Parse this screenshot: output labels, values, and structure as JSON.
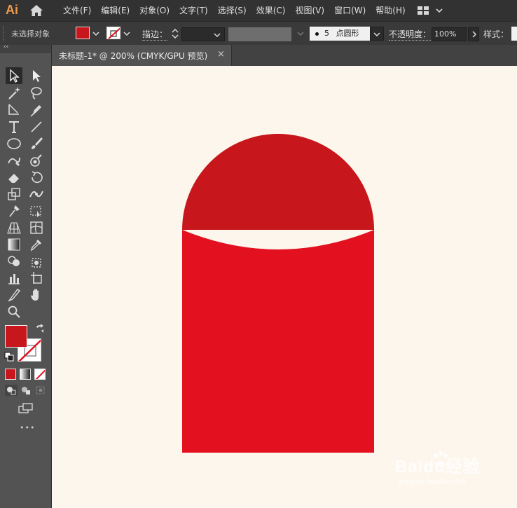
{
  "app": {
    "logo": "Ai",
    "home_icon": "home-icon",
    "workspace_icon": "workspace-switcher-icon"
  },
  "menus": [
    "文件(F)",
    "编辑(E)",
    "对象(O)",
    "文字(T)",
    "选择(S)",
    "效果(C)",
    "视图(V)",
    "窗口(W)",
    "帮助(H)"
  ],
  "control": {
    "selection_status": "未选择对象",
    "fill_color": "#c8161d",
    "stroke_label": "描边：",
    "brush_size": "5",
    "brush_name": "点圆形",
    "opacity_label": "不透明度：",
    "opacity_value": "100%",
    "style_label": "样式："
  },
  "document_tab": {
    "title": "未标题-1* @ 200% (CMYK/GPU 预览)",
    "close": "×"
  },
  "toolbox": {
    "collapse": "‹‹",
    "more": "•••",
    "fill_color": "#c8161d"
  },
  "artwork": {
    "semicircle_color": "#c8161d",
    "body_color": "#e31020",
    "background": "#fdf6ec"
  },
  "watermark": {
    "brand": "Baidu经验",
    "url": "jingyan.baidu.com"
  }
}
